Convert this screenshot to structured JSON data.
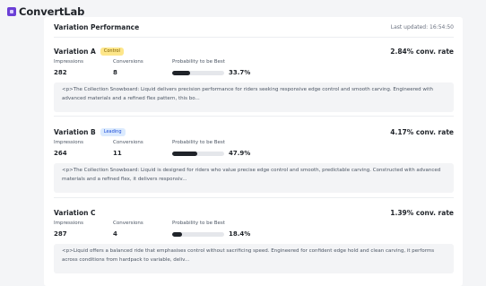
{
  "app": {
    "name": "ConvertLab"
  },
  "panel": {
    "title": "Variation Performance",
    "last_updated": "Last updated: 16:54:50"
  },
  "labels": {
    "impressions": "Impressions",
    "conversions": "Conversions",
    "probability": "Probability to be Best"
  },
  "variations": [
    {
      "name": "Variation A",
      "badge": "Control",
      "badge_type": "control",
      "conv_rate": "2.84% conv. rate",
      "impressions": "282",
      "conversions": "8",
      "probability": "33.7%",
      "probability_value": 33.7,
      "description": "<p>The Collection Snowboard: Liquid delivers precision performance for riders seeking responsive edge control and smooth carving. Engineered with advanced materials and a refined flex pattern, this bo..."
    },
    {
      "name": "Variation B",
      "badge": "Leading",
      "badge_type": "leading",
      "conv_rate": "4.17% conv. rate",
      "impressions": "264",
      "conversions": "11",
      "probability": "47.9%",
      "probability_value": 47.9,
      "description": "<p>The Collection Snowboard: Liquid is designed for riders who value precise edge control and smooth, predictable carving. Constructed with advanced materials and a refined flex, it delivers responsiv..."
    },
    {
      "name": "Variation C",
      "badge": "",
      "badge_type": "",
      "conv_rate": "1.39% conv. rate",
      "impressions": "287",
      "conversions": "4",
      "probability": "18.4%",
      "probability_value": 18.4,
      "description": "<p>Liquid offers a balanced ride that emphasises control without sacrificing speed. Engineered for confident edge hold and clean carving, it performs across conditions from hardpack to variable, deliv..."
    }
  ],
  "colors": {
    "brand": "#6b3fd6",
    "control_badge": "#fde68a",
    "leading_badge": "#dbeafe",
    "bar_fill": "#1f2329",
    "bar_track": "#e5e7eb"
  }
}
